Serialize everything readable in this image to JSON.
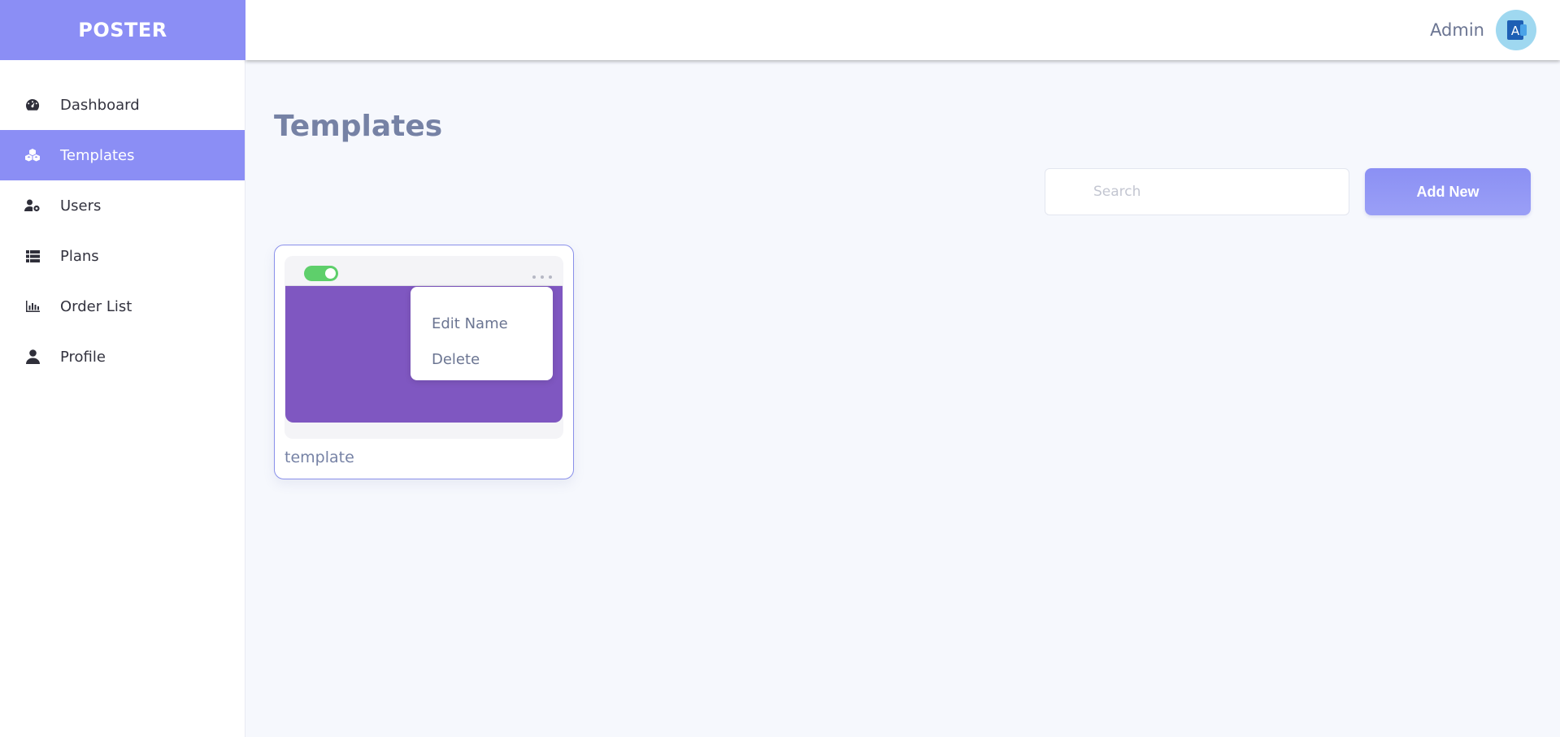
{
  "app": {
    "brand": "POSTER"
  },
  "sidebar": {
    "items": [
      {
        "label": "Dashboard",
        "icon": "gauge-icon",
        "active": false
      },
      {
        "label": "Templates",
        "icon": "cubes-icon",
        "active": true
      },
      {
        "label": "Users",
        "icon": "user-gear-icon",
        "active": false
      },
      {
        "label": "Plans",
        "icon": "list-icon",
        "active": false
      },
      {
        "label": "Order List",
        "icon": "bar-chart-icon",
        "active": false
      },
      {
        "label": "Profile",
        "icon": "user-icon",
        "active": false
      }
    ]
  },
  "header": {
    "user_name": "Admin",
    "avatar_letter": "A"
  },
  "main": {
    "title": "Templates",
    "search": {
      "placeholder": "Search",
      "value": ""
    },
    "add_button": "Add New",
    "cards": [
      {
        "name": "template",
        "enabled": true,
        "thumbnail_color": "#7f57c1"
      }
    ],
    "context_menu": {
      "items": [
        "Edit Name",
        "Delete"
      ]
    }
  },
  "colors": {
    "accent": "#8b8ef5",
    "page_bg": "#f6f8fd",
    "toggle_on": "#5ecf6b",
    "title_text": "#7682a5"
  }
}
